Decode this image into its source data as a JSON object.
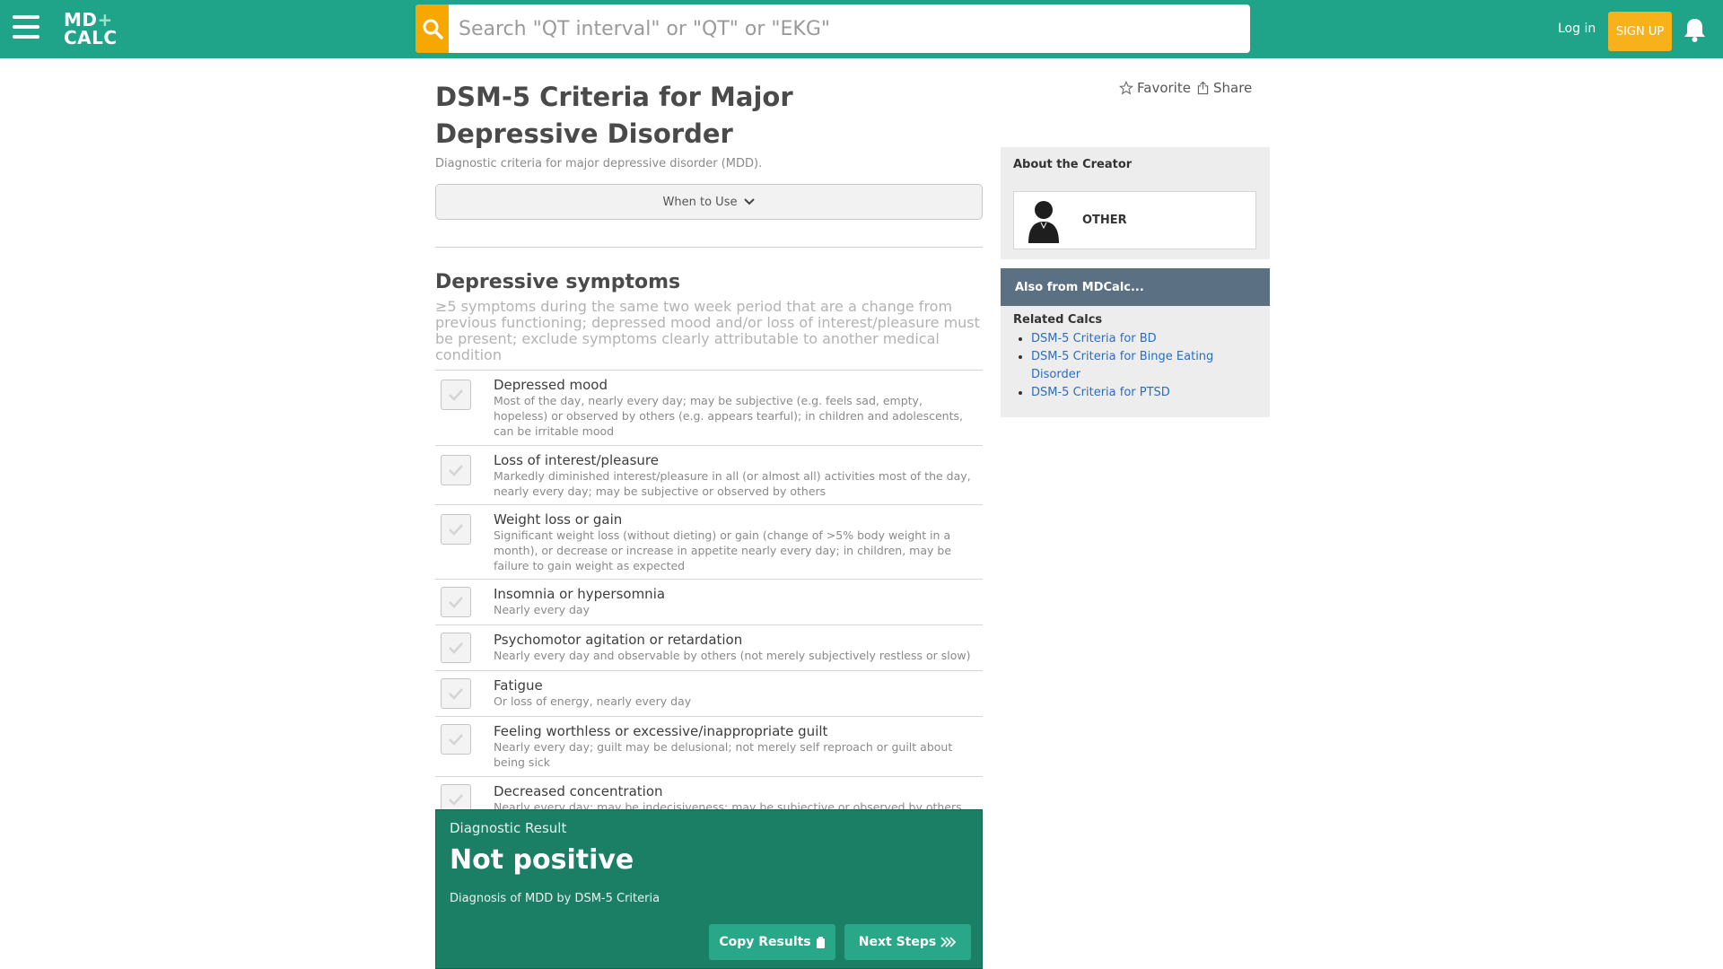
{
  "header": {
    "logo_top": "MD",
    "logo_plus": "+",
    "logo_bottom": "CALC",
    "search_placeholder": "Search \"QT interval\" or \"QT\" or \"EKG\"",
    "login_label": "Log in",
    "signup_label": "SIGN UP"
  },
  "page": {
    "title": "DSM-5 Criteria for Major Depressive Disorder",
    "subtitle": "Diagnostic criteria for major depressive disorder (MDD).",
    "favorite_label": "Favorite",
    "share_label": "Share",
    "when_to_use_label": "When to Use"
  },
  "section": {
    "title": "Depressive symptoms",
    "description": "≥5 symptoms during the same two week period that are a change from previous functioning; depressed mood and/or loss of interest/pleasure must be present; exclude symptoms clearly attributable to another medical condition"
  },
  "criteria": [
    {
      "label": "Depressed mood",
      "desc": "Most of the day, nearly every day; may be subjective (e.g. feels sad, empty, hopeless) or observed by others (e.g. appears tearful); in children and adolescents, can be irritable mood",
      "checked": false
    },
    {
      "label": "Loss of interest/pleasure",
      "desc": "Markedly diminished interest/pleasure in all (or almost all) activities most of the day, nearly every day; may be subjective or observed by others",
      "checked": false
    },
    {
      "label": "Weight loss or gain",
      "desc": "Significant weight loss (without dieting) or gain (change of >5% body weight in a month), or decrease or increase in appetite nearly every day; in children, may be failure to gain weight as expected",
      "checked": false
    },
    {
      "label": "Insomnia or hypersomnia",
      "desc": "Nearly every day",
      "checked": false
    },
    {
      "label": "Psychomotor agitation or retardation",
      "desc": "Nearly every day and observable by others (not merely subjectively restless or slow)",
      "checked": false
    },
    {
      "label": "Fatigue",
      "desc": "Or loss of energy, nearly every day",
      "checked": false
    },
    {
      "label": "Feeling worthless or excessive/inappropriate guilt",
      "desc": "Nearly every day; guilt may be delusional; not merely self reproach or guilt about being sick",
      "checked": false
    },
    {
      "label": "Decreased concentration",
      "desc": "Nearly every day; may be indecisiveness; may be subjective or observed by others",
      "checked": false
    }
  ],
  "result": {
    "label": "Diagnostic Result",
    "value": "Not positive",
    "subtext": "Diagnosis of MDD by DSM-5 Criteria",
    "copy_label": "Copy Results",
    "next_label": "Next Steps"
  },
  "sidebar": {
    "creator_heading": "About the Creator",
    "creator_name": "OTHER",
    "also_heading": "Also from MDCalc...",
    "related_heading": "Related Calcs",
    "related": [
      {
        "label": "DSM-5 Criteria for BD"
      },
      {
        "label": "DSM-5 Criteria for Binge Eating Disorder"
      },
      {
        "label": "DSM-5 Criteria for PTSD"
      }
    ]
  },
  "colors": {
    "brand_green": "#1fa389",
    "result_green": "#1b7f66",
    "search_orange": "#f6a800",
    "signup_yellow": "#f7b21b",
    "sidebar_header": "#5c7084",
    "link_blue": "#2a6ec2"
  }
}
